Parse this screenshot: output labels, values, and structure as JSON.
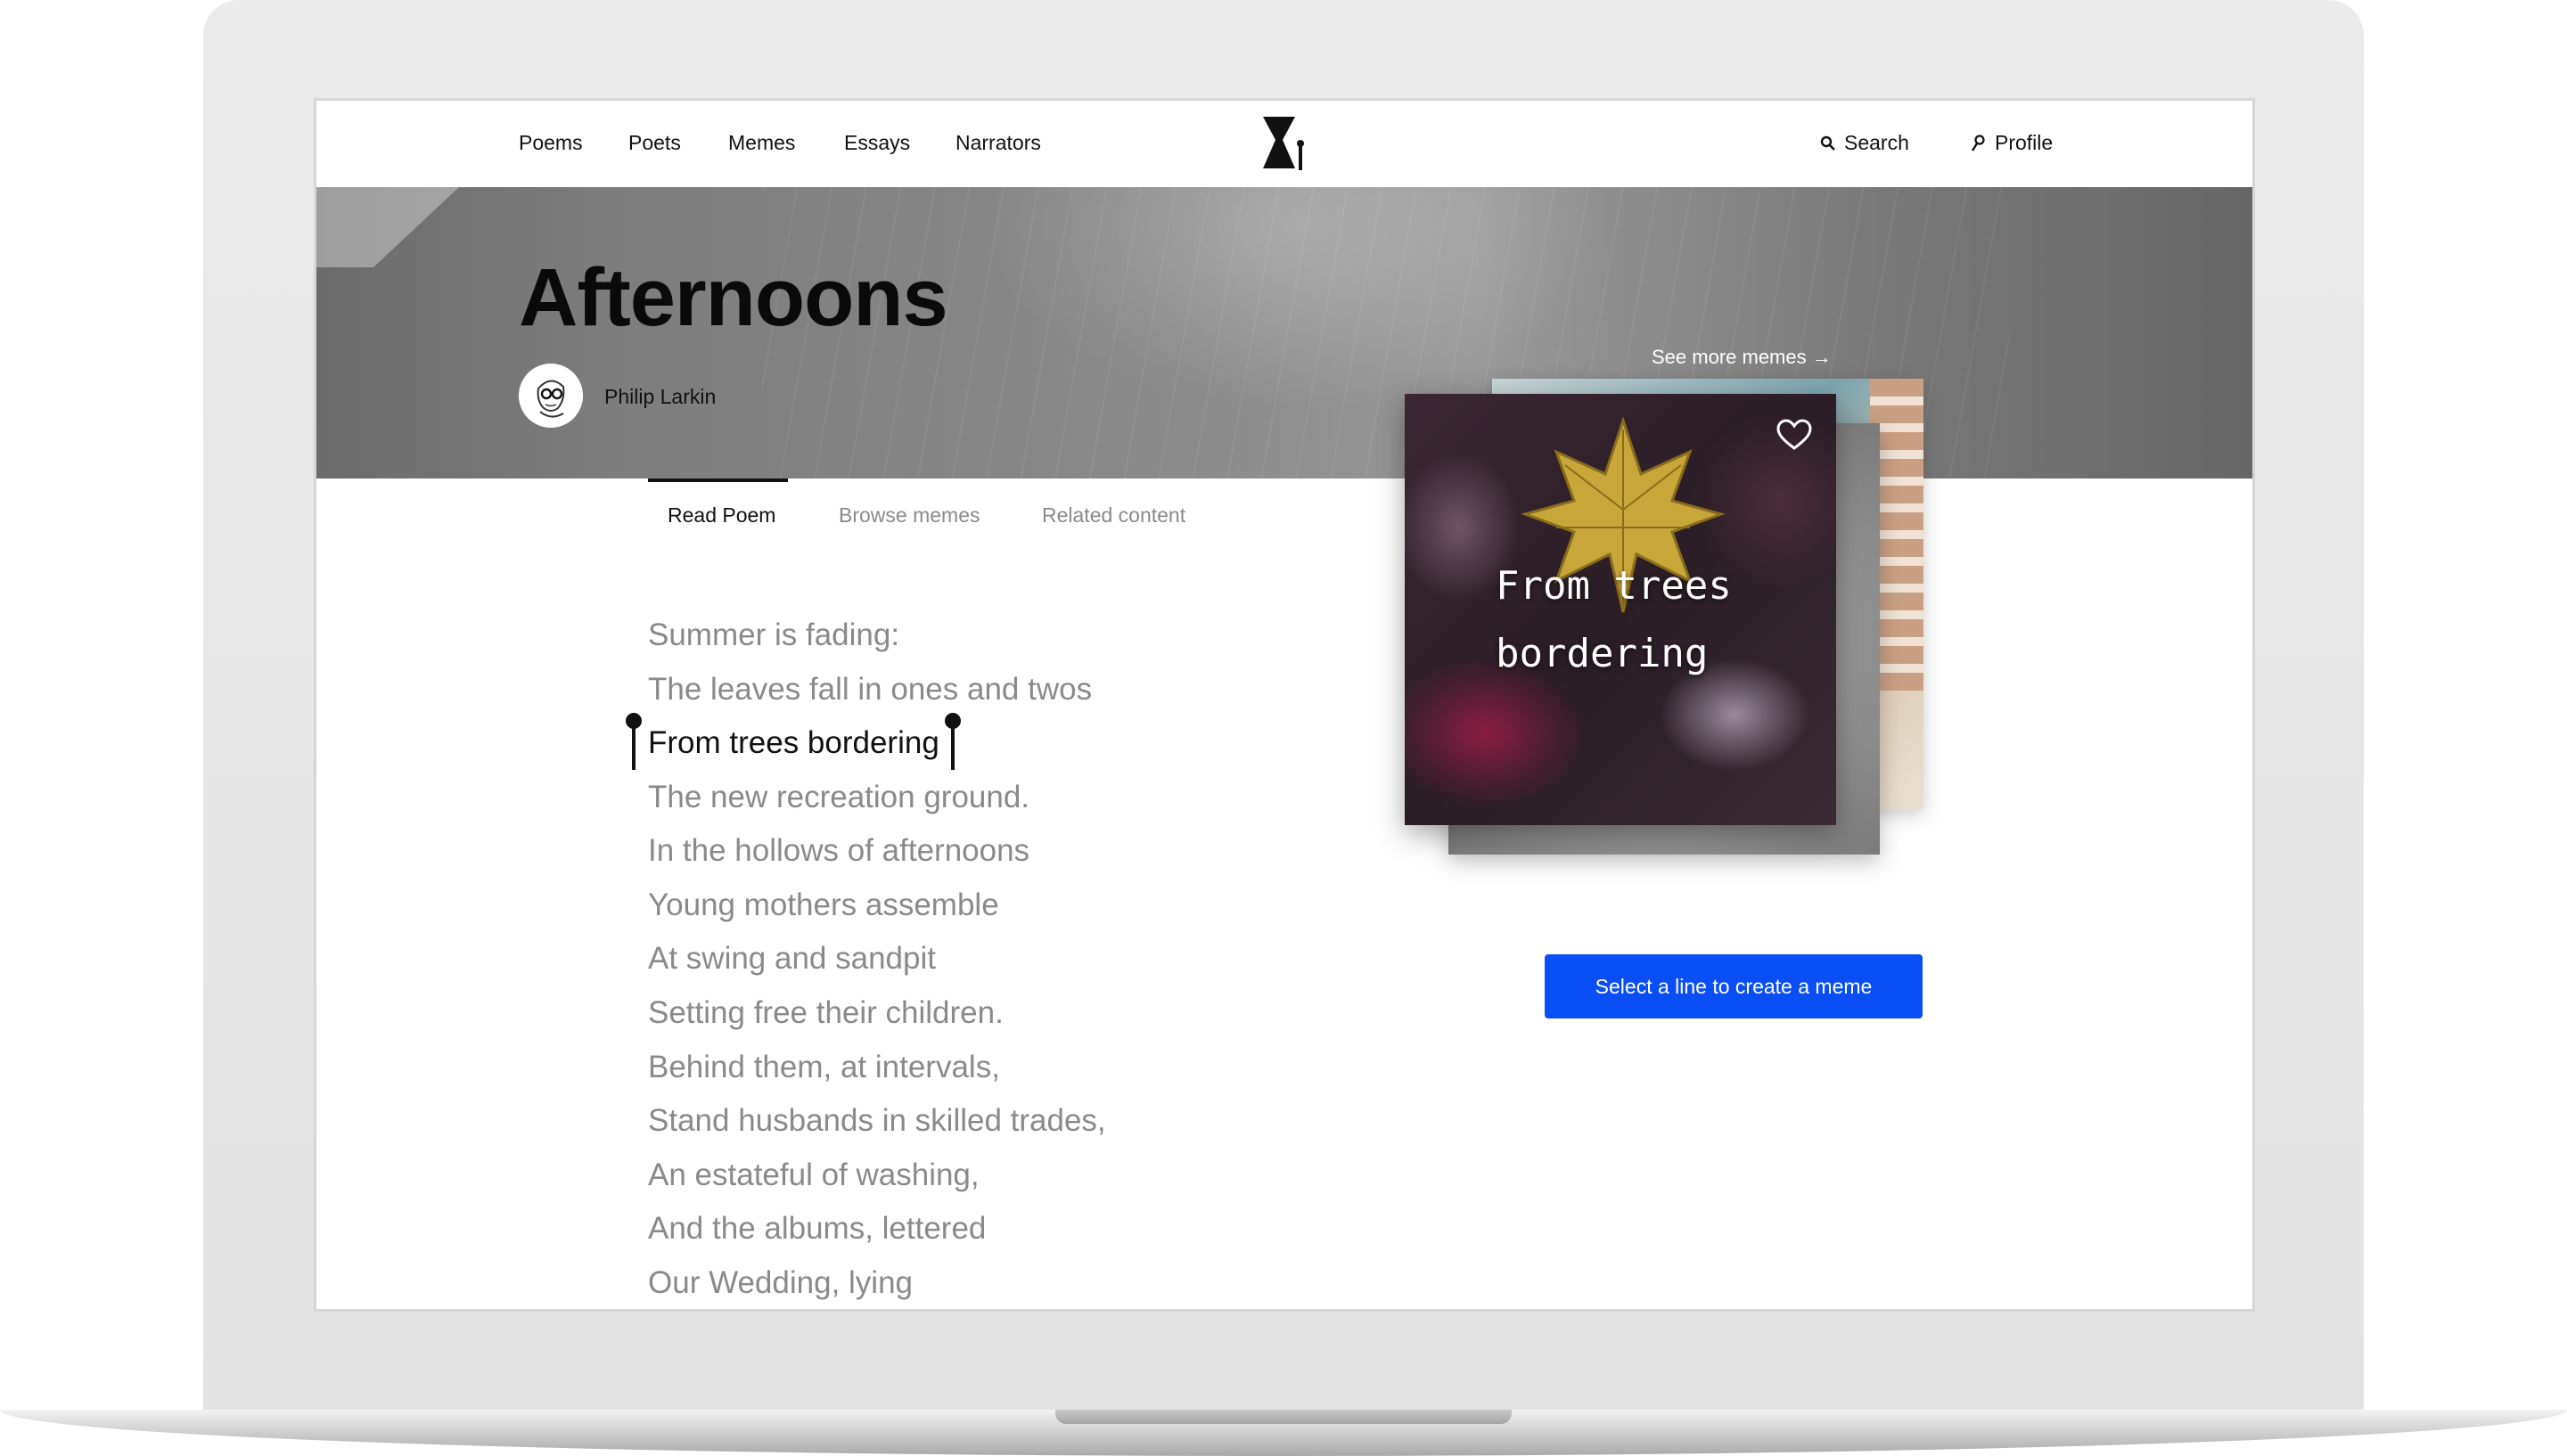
{
  "nav": {
    "items": [
      "Poems",
      "Poets",
      "Memes",
      "Essays",
      "Narrators"
    ],
    "search_label": "Search",
    "profile_label": "Profile"
  },
  "poem": {
    "title": "Afternoons",
    "author": "Philip Larkin",
    "see_more": "See more memes →",
    "lines": [
      "Summer is fading:",
      "The leaves fall in ones and twos",
      "From trees bordering",
      "The new recreation ground.",
      "In the hollows of afternoons",
      "Young mothers assemble",
      "At swing and sandpit",
      "Setting free their children.",
      "Behind them, at intervals,",
      "Stand husbands in skilled trades,",
      "An estateful of washing,",
      "And the albums, lettered",
      "Our Wedding, lying"
    ],
    "selected_line_index": 2
  },
  "tabs": [
    {
      "label": "Read Poem",
      "active": true
    },
    {
      "label": "Browse memes",
      "active": false
    },
    {
      "label": "Related content",
      "active": false
    }
  ],
  "meme": {
    "text_line1": "From trees",
    "text_line2": "bordering"
  },
  "cta": {
    "label": "Select a line to create a meme",
    "color": "#0a4ef5"
  }
}
